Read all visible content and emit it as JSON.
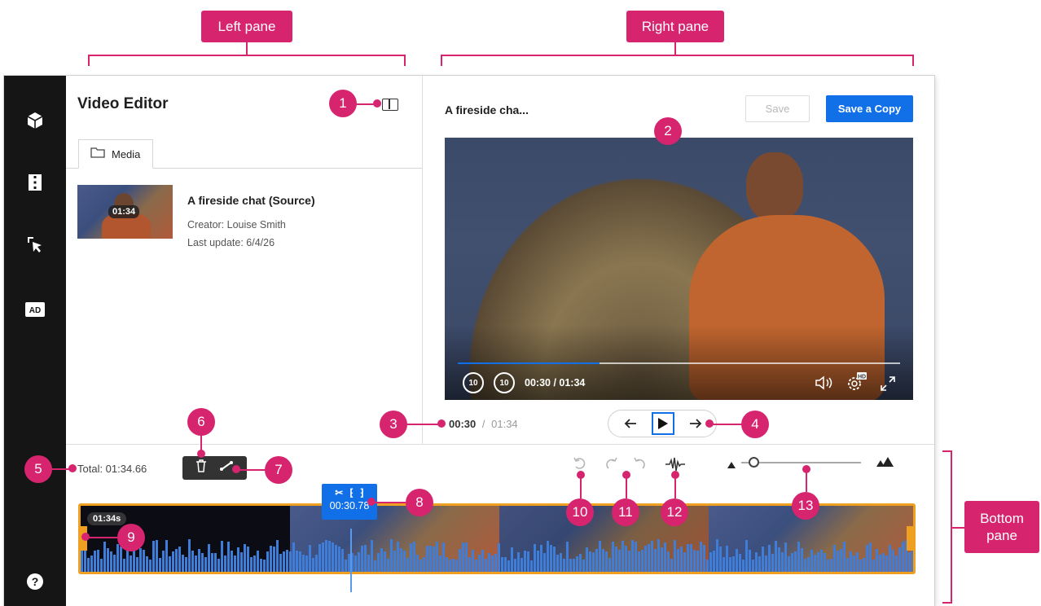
{
  "callouts": {
    "left_pane": "Left pane",
    "right_pane": "Right pane",
    "bottom_pane": "Bottom pane",
    "markers": [
      "1",
      "2",
      "3",
      "4",
      "5",
      "6",
      "7",
      "8",
      "9",
      "10",
      "11",
      "12",
      "13"
    ]
  },
  "left_pane": {
    "title": "Video Editor",
    "layout_toggle_icon": "split-panel-icon",
    "tab_label": "Media",
    "media_item": {
      "title": "A fireside chat (Source)",
      "duration": "01:34",
      "creator": "Creator: Louise Smith",
      "last_update": "Last update: 6/4/26"
    }
  },
  "right_pane": {
    "title": "A fireside cha...",
    "save_label": "Save",
    "save_copy_label": "Save a Copy",
    "player_time": "00:30 / 01:34",
    "progress": 0.32,
    "current_time": "00:30",
    "separator": "/",
    "total_time": "01:34"
  },
  "bottom_pane": {
    "total": "Total: 01:34.66",
    "clip_duration": "01:34s",
    "playhead_time": "00:30.78",
    "zoom_level": 0.1
  },
  "colors": {
    "accent": "#d6246e",
    "primary": "#1170e8",
    "clip_border": "#f0a020",
    "rail": "#151515"
  }
}
